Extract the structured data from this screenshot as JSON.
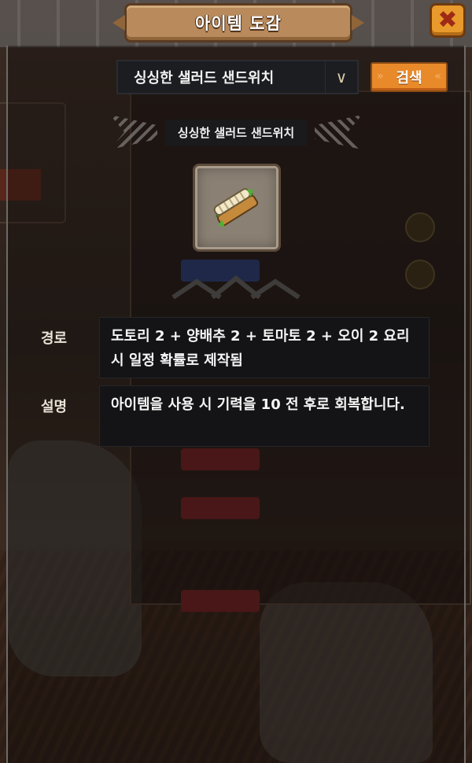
{
  "window": {
    "title": "아이템 도감",
    "close_icon": "close-x-icon"
  },
  "search": {
    "selected_item": "싱싱한 샐러드 샌드위치",
    "dropdown_icon": "chevron-down-icon",
    "button_label": "검색"
  },
  "item": {
    "name": "싱싱한 샐러드 샌드위치",
    "icon": "sandwich-icon",
    "route_label": "경로",
    "route_text": "도토리 2 + 양배추 2 + 토마토 2 + 오이 2 요리 시 일정 확률로 제작됨",
    "description_label": "설명",
    "description_text": "아이템을 사용 시 기력을 10 전 후로 회복합니다."
  },
  "colors": {
    "banner": "#b98a5c",
    "close_button": "#e89a2c",
    "search_button": "#e98a2a",
    "panel": "#141416"
  }
}
